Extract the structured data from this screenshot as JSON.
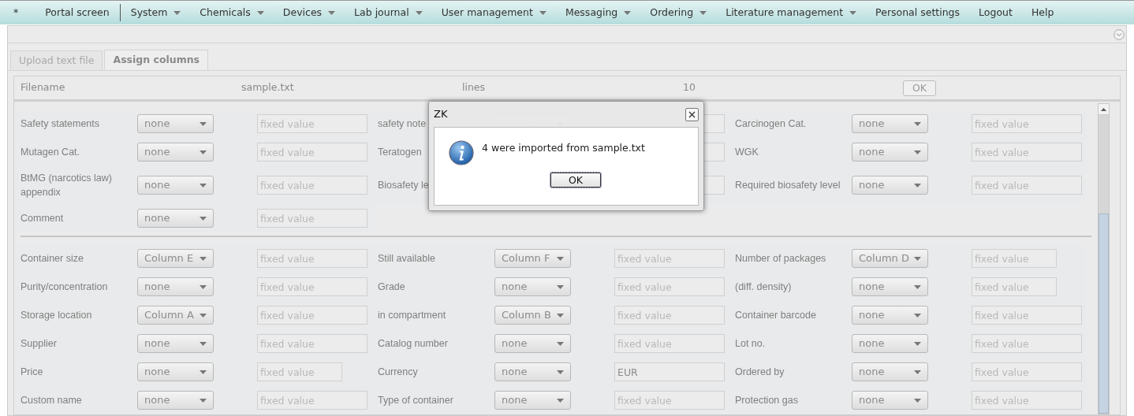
{
  "menu": [
    {
      "label": "*",
      "dropdown": false
    },
    {
      "label": "Portal screen",
      "dropdown": false
    },
    {
      "label": "System",
      "dropdown": true
    },
    {
      "label": "Chemicals",
      "dropdown": true
    },
    {
      "label": "Devices",
      "dropdown": true
    },
    {
      "label": "Lab journal",
      "dropdown": true
    },
    {
      "label": "User management",
      "dropdown": true
    },
    {
      "label": "Messaging",
      "dropdown": true
    },
    {
      "label": "Ordering",
      "dropdown": true
    },
    {
      "label": "Literature management",
      "dropdown": true
    },
    {
      "label": "Personal settings",
      "dropdown": false
    },
    {
      "label": "Logout",
      "dropdown": false
    },
    {
      "label": "Help",
      "dropdown": false
    }
  ],
  "tabs": [
    {
      "label": "Upload text file",
      "selected": false
    },
    {
      "label": "Assign columns",
      "selected": true
    }
  ],
  "file_info": {
    "filename_label": "Filename",
    "filename": "sample.txt",
    "lines_label": "lines",
    "lines": "10",
    "ok": "OK"
  },
  "sections": [
    {
      "rows": [
        {
          "cells": [
            {
              "label": "Safety statements",
              "select": "none",
              "field": {
                "placeholder": "fixed value",
                "short": false
              }
            },
            {
              "label": "safety note",
              "field": {
                "short": false
              }
            },
            {
              "label": "Carcinogen Cat.",
              "select": "none",
              "field": {
                "placeholder": "fixed value",
                "short": false
              }
            }
          ]
        },
        {
          "cells": [
            {
              "label": "Mutagen Cat.",
              "select": "none",
              "field": {
                "placeholder": "fixed value",
                "short": false
              }
            },
            {
              "label": "Teratogen",
              "field": {
                "short": false
              }
            },
            {
              "label": "WGK",
              "select": "none",
              "field": {
                "placeholder": "fixed value",
                "short": false
              }
            }
          ]
        },
        {
          "cells": [
            {
              "label": "BtMG (narcotics law) appendix",
              "select": "none",
              "field": {
                "placeholder": "fixed value",
                "short": false
              }
            },
            {
              "label": "Biosafety le",
              "field": {
                "short": false
              }
            },
            {
              "label": "Required biosafety level",
              "select": "none",
              "field": {
                "placeholder": "fixed value",
                "short": false
              }
            }
          ]
        },
        {
          "cells": [
            {
              "label": "Comment",
              "select": "none",
              "field": {
                "placeholder": "fixed value",
                "short": false
              }
            }
          ]
        }
      ]
    },
    {
      "rows": [
        {
          "cells": [
            {
              "label": "Container size",
              "select": "Column E",
              "field": {
                "placeholder": "fixed value",
                "short": false
              }
            },
            {
              "label": "Still available",
              "select": "Column F",
              "field": {
                "placeholder": "fixed value",
                "short": false
              }
            },
            {
              "label": "Number of packages",
              "select": "Column D",
              "field": {
                "placeholder": "fixed value",
                "short": true
              }
            }
          ]
        },
        {
          "cells": [
            {
              "label": "Purity/concentration",
              "select": "none",
              "field": {
                "placeholder": "fixed value",
                "short": false
              }
            },
            {
              "label": "Grade",
              "select": "none",
              "field": {
                "placeholder": "fixed value",
                "short": false
              }
            },
            {
              "label": "(diff. density)",
              "select": "none",
              "field": {
                "placeholder": "fixed value",
                "short": true
              }
            }
          ]
        },
        {
          "cells": [
            {
              "label": "Storage location",
              "select": "Column A",
              "field": {
                "placeholder": "fixed value",
                "short": false
              }
            },
            {
              "label": "in compartment",
              "select": "Column B",
              "field": {
                "placeholder": "fixed value",
                "short": false
              }
            },
            {
              "label": "Container barcode",
              "select": "none",
              "field": {
                "placeholder": "fixed value",
                "short": false
              }
            }
          ]
        },
        {
          "cells": [
            {
              "label": "Supplier",
              "select": "none",
              "field": {
                "placeholder": "fixed value",
                "short": false
              }
            },
            {
              "label": "Catalog number",
              "select": "none",
              "field": {
                "placeholder": "fixed value",
                "short": false
              }
            },
            {
              "label": "Lot no.",
              "select": "none",
              "field": {
                "placeholder": "fixed value",
                "short": false
              }
            }
          ]
        },
        {
          "cells": [
            {
              "label": "Price",
              "select": "none",
              "field": {
                "placeholder": "fixed value",
                "short": true
              }
            },
            {
              "label": "Currency",
              "select": "none",
              "field": {
                "value": "EUR",
                "short": false
              }
            },
            {
              "label": "Ordered by",
              "select": "none",
              "field": {
                "placeholder": "fixed value",
                "short": false
              }
            }
          ]
        },
        {
          "cells": [
            {
              "label": "Custom name",
              "select": "none",
              "field": {
                "placeholder": "fixed value",
                "short": false
              }
            },
            {
              "label": "Type of container",
              "select": "none",
              "field": {
                "placeholder": "fixed value",
                "short": false
              }
            },
            {
              "label": "Protection gas",
              "select": "none",
              "field": {
                "placeholder": "fixed value",
                "short": false
              }
            }
          ]
        }
      ]
    }
  ],
  "dialog": {
    "title": "ZK",
    "message": "4 were imported from sample.txt",
    "ok": "OK"
  }
}
